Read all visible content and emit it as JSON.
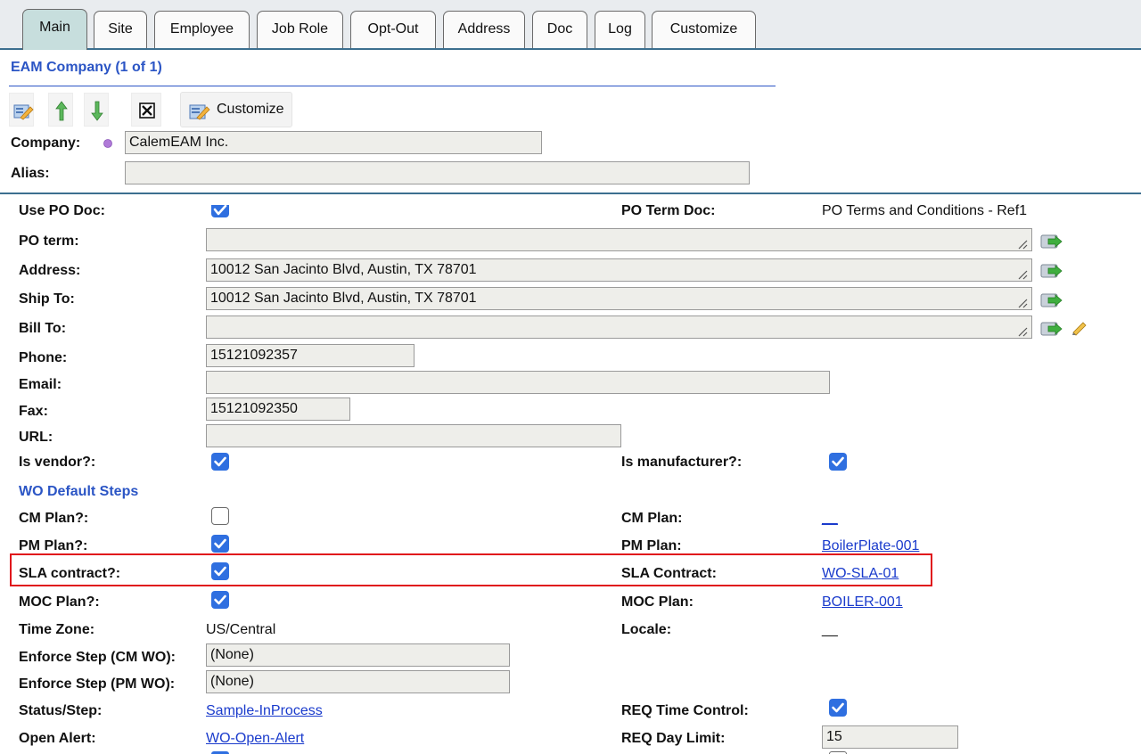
{
  "tabs": [
    {
      "label": "Main",
      "active": true
    },
    {
      "label": "Site"
    },
    {
      "label": "Employee"
    },
    {
      "label": "Job Role"
    },
    {
      "label": "Opt-Out"
    },
    {
      "label": "Address"
    },
    {
      "label": "Doc"
    },
    {
      "label": "Log"
    },
    {
      "label": "Customize"
    }
  ],
  "panel": {
    "title": "EAM Company (1 of 1)",
    "customize_label": "Customize"
  },
  "company": {
    "company_label": "Company:",
    "company_value": "CalemEAM Inc.",
    "alias_label": "Alias:",
    "alias_value": ""
  },
  "form": {
    "use_po_doc": {
      "label": "Use PO Doc:",
      "checked": true
    },
    "po_term_doc": {
      "label": "PO Term Doc:",
      "value": "PO Terms and Conditions - Ref1"
    },
    "po_term": {
      "label": "PO term:",
      "value": ""
    },
    "address": {
      "label": "Address:",
      "value": "10012 San Jacinto Blvd, Austin, TX 78701"
    },
    "ship_to": {
      "label": "Ship To:",
      "value": "10012 San Jacinto Blvd, Austin, TX 78701"
    },
    "bill_to": {
      "label": "Bill To:",
      "value": ""
    },
    "phone": {
      "label": "Phone:",
      "value": "15121092357"
    },
    "email": {
      "label": "Email:",
      "value": ""
    },
    "fax": {
      "label": "Fax:",
      "value": "15121092350"
    },
    "url": {
      "label": "URL:",
      "value": ""
    },
    "is_vendor": {
      "label": "Is vendor?:",
      "checked": true
    },
    "is_manufacturer": {
      "label": "Is manufacturer?:",
      "checked": true
    },
    "wo_section": "WO Default Steps",
    "cm_plan_q": {
      "label": "CM Plan?:",
      "checked": false
    },
    "cm_plan": {
      "label": "CM Plan:",
      "value": "__"
    },
    "pm_plan_q": {
      "label": "PM Plan?:",
      "checked": true
    },
    "pm_plan": {
      "label": "PM Plan:",
      "value": "BoilerPlate-001"
    },
    "sla_q": {
      "label": "SLA contract?:",
      "checked": true
    },
    "sla": {
      "label": "SLA Contract:",
      "value": "WO-SLA-01"
    },
    "moc_q": {
      "label": "MOC Plan?:",
      "checked": true
    },
    "moc": {
      "label": "MOC Plan:",
      "value": "BOILER-001"
    },
    "time_zone": {
      "label": "Time Zone:",
      "value": "US/Central"
    },
    "locale": {
      "label": "Locale:",
      "value": "__"
    },
    "enforce_cm": {
      "label": "Enforce Step (CM WO):",
      "value": "(None)"
    },
    "enforce_pm": {
      "label": "Enforce Step (PM WO):",
      "value": "(None)"
    },
    "status_step": {
      "label": "Status/Step:",
      "value": "Sample-InProcess"
    },
    "req_time": {
      "label": "REQ Time Control:",
      "checked": true
    },
    "open_alert": {
      "label": "Open Alert:",
      "value": "WO-Open-Alert"
    },
    "req_day": {
      "label": "REQ Day Limit:",
      "value": "15"
    }
  }
}
